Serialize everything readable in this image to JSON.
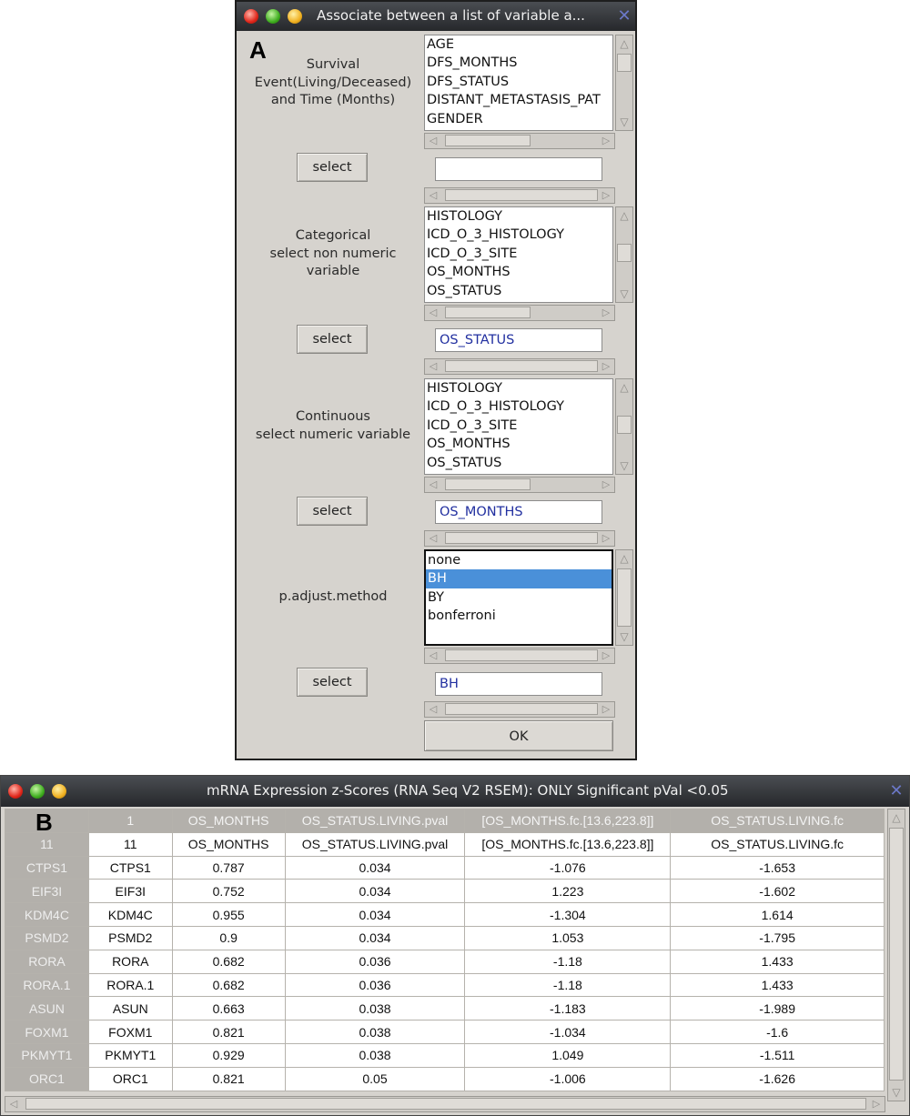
{
  "windowA": {
    "title": "Associate between a list of variable a...",
    "panel_letter": "A",
    "sections": [
      {
        "label_lines": [
          "Survival",
          "Event(Living/Deceased)",
          "and Time (Months)"
        ],
        "list_items": [
          "AGE",
          "DFS_MONTHS",
          "DFS_STATUS",
          "DISTANT_METASTASIS_PAT",
          "GENDER"
        ],
        "select_label": "select",
        "entry_value": ""
      },
      {
        "label_lines": [
          "Categorical",
          "select non numeric",
          "variable"
        ],
        "list_items": [
          "HISTOLOGY",
          "ICD_O_3_HISTOLOGY",
          "ICD_O_3_SITE",
          "OS_MONTHS",
          "OS_STATUS"
        ],
        "select_label": "select",
        "entry_value": "OS_STATUS"
      },
      {
        "label_lines": [
          "Continuous",
          "select numeric variable"
        ],
        "list_items": [
          "HISTOLOGY",
          "ICD_O_3_HISTOLOGY",
          "ICD_O_3_SITE",
          "OS_MONTHS",
          "OS_STATUS"
        ],
        "select_label": "select",
        "entry_value": "OS_MONTHS"
      },
      {
        "label_lines": [
          "p.adjust.method"
        ],
        "list_items": [
          "none",
          "BH",
          "BY",
          "bonferroni"
        ],
        "selected_item": "BH",
        "select_label": "select",
        "entry_value": "BH"
      }
    ],
    "ok_label": "OK"
  },
  "windowB": {
    "title": "mRNA Expression z-Scores (RNA Seq V2 RSEM): ONLY Significant pVal <0.05",
    "panel_letter": "B",
    "header_row": [
      "",
      "1",
      "OS_MONTHS",
      "OS_STATUS.LIVING.pval",
      "[OS_MONTHS.fc.[13.6,223.8]]",
      "OS_STATUS.LIVING.fc"
    ],
    "rows": [
      [
        "11",
        "11",
        "OS_MONTHS",
        "OS_STATUS.LIVING.pval",
        "[OS_MONTHS.fc.[13.6,223.8]]",
        "OS_STATUS.LIVING.fc"
      ],
      [
        "CTPS1",
        "CTPS1",
        "0.787",
        "0.034",
        "-1.076",
        "-1.653"
      ],
      [
        "EIF3I",
        "EIF3I",
        "0.752",
        "0.034",
        "1.223",
        "-1.602"
      ],
      [
        "KDM4C",
        "KDM4C",
        "0.955",
        "0.034",
        "-1.304",
        "1.614"
      ],
      [
        "PSMD2",
        "PSMD2",
        "0.9",
        "0.034",
        "1.053",
        "-1.795"
      ],
      [
        "RORA",
        "RORA",
        "0.682",
        "0.036",
        "-1.18",
        "1.433"
      ],
      [
        "RORA.1",
        "RORA.1",
        "0.682",
        "0.036",
        "-1.18",
        "1.433"
      ],
      [
        "ASUN",
        "ASUN",
        "0.663",
        "0.038",
        "-1.183",
        "-1.989"
      ],
      [
        "FOXM1",
        "FOXM1",
        "0.821",
        "0.038",
        "-1.034",
        "-1.6"
      ],
      [
        "PKMYT1",
        "PKMYT1",
        "0.929",
        "0.038",
        "1.049",
        "-1.511"
      ],
      [
        "ORC1",
        "ORC1",
        "0.821",
        "0.05",
        "-1.006",
        "-1.626"
      ]
    ]
  }
}
